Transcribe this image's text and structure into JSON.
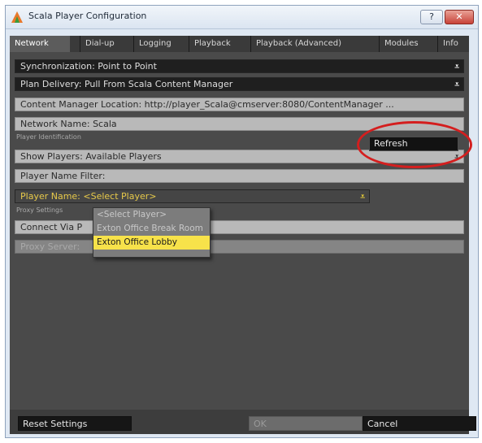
{
  "window": {
    "title": "Scala Player Configuration",
    "help_label": "?",
    "close_label": "✕"
  },
  "tabs": [
    "Network",
    "Dial-up",
    "Logging",
    "Playback",
    "Playback (Advanced)",
    "Modules",
    "Info"
  ],
  "rows": {
    "synchronization": "Synchronization:  Point to Point",
    "plan_delivery": "Plan Delivery:  Pull From Scala Content Manager",
    "cm_location": "Content Manager Location:  http://player_Scala@cmserver:8080/ContentManager ...",
    "network_name": "Network Name:  Scala",
    "player_identification_label": "Player Identification",
    "show_players": "Show Players:  Available Players",
    "player_name_filter": "Player Name Filter:",
    "player_name": "Player Name:  <Select Player>",
    "proxy_settings_label": "Proxy Settings",
    "connect_via": "Connect Via P",
    "proxy_server": "Proxy Server:"
  },
  "refresh_label": "Refresh",
  "dropdown_options": [
    "<Select Player>",
    "Exton Office Break Room",
    "Exton Office Lobby"
  ],
  "selected_option": "Exton Office Lobby",
  "buttons": {
    "reset": "Reset Settings",
    "ok": "OK",
    "cancel": "Cancel"
  },
  "colors": {
    "annotation_ring": "#d41e1e",
    "highlight": "#f7e24a",
    "accent_text": "#e7c94a"
  }
}
